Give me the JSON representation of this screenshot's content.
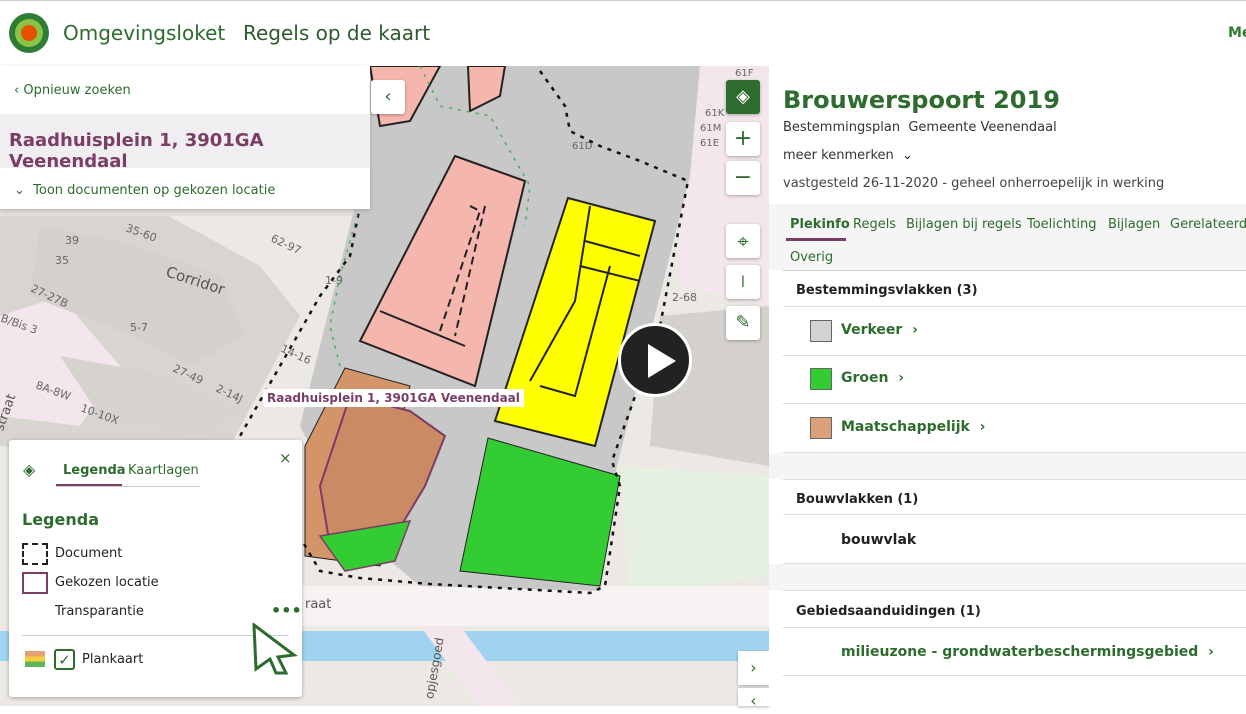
{
  "header": {
    "brand_prefix": "Omgevings",
    "brand_suffix": "loket",
    "app_title": "Regels op de kaart",
    "menu_cut": "Me"
  },
  "search": {
    "back_label": "Opnieuw zoeken",
    "address": "Raadhuisplein 1, 3901GA Veenendaal",
    "toon_documenten": "Toon documenten op gekozen locatie"
  },
  "map": {
    "location_label": "Raadhuisplein 1, 3901GA Veenendaal",
    "street_labels": [
      "Corridor",
      "35-60",
      "39",
      "35",
      "62-97",
      "27-27B",
      "B/Bis 3",
      "5-7",
      "27-49",
      "14-16",
      "8A-8W",
      "10-10X",
      "2-14J",
      "1-9",
      "2-68",
      "61D",
      "61F",
      "61M",
      "61K",
      "61E",
      "straat",
      "raat",
      "opjesgoed"
    ],
    "controls": {
      "layers_icon": "layers-icon",
      "zoom_in": "+",
      "zoom_out": "−",
      "locate_icon": "crosshair-icon",
      "measure_icon": "ruler-icon",
      "draw_icon": "pencil-icon",
      "collapse": "‹",
      "next": "›",
      "prev": "‹"
    },
    "colors": {
      "road": "#c8c8c8",
      "verkeer_zone": "#f5b6ae",
      "groen": "#33cc33",
      "yellow": "#ffff00",
      "maatschappelijk": "#d4946a",
      "water": "#9fd3f0"
    }
  },
  "legend": {
    "tab_active": "Legenda",
    "tab_inactive": "Kaartlagen",
    "close": "×",
    "heading": "Legenda",
    "rows": {
      "document": "Document",
      "gekozen_locatie": "Gekozen locatie",
      "transparantie": "Transparantie"
    },
    "more": "•••",
    "plankaart": "Plankaart",
    "checkmark": "✓"
  },
  "panel": {
    "title": "Brouwerspoort 2019",
    "subtitle_type": "Bestemmingsplan",
    "subtitle_org": "Gemeente Veenendaal",
    "meer": "meer kenmerken",
    "status": "vastgesteld 26-11-2020 - geheel onherroepelijk in werking",
    "tabs": [
      "Plekinfo",
      "Regels",
      "Bijlagen bij regels",
      "Toelichting",
      "Bijlagen",
      "Gerelateerd",
      "Overig"
    ],
    "sections": {
      "bestemmingsvlakken": {
        "title": "Bestemmingsvlakken (3)",
        "items": [
          {
            "label": "Verkeer",
            "color": "#d3d3d3"
          },
          {
            "label": "Groen",
            "color": "#33cc33"
          },
          {
            "label": "Maatschappelijk",
            "color": "#d9a07a"
          }
        ]
      },
      "bouwvlakken": {
        "title": "Bouwvlakken (1)",
        "items": [
          {
            "label": "bouwvlak"
          }
        ]
      },
      "gebiedsaanduidingen": {
        "title": "Gebiedsaanduidingen (1)",
        "items": [
          {
            "label": "milieuzone - grondwaterbeschermingsgebied"
          }
        ]
      }
    },
    "chevron": "›",
    "caret": "⌄"
  }
}
